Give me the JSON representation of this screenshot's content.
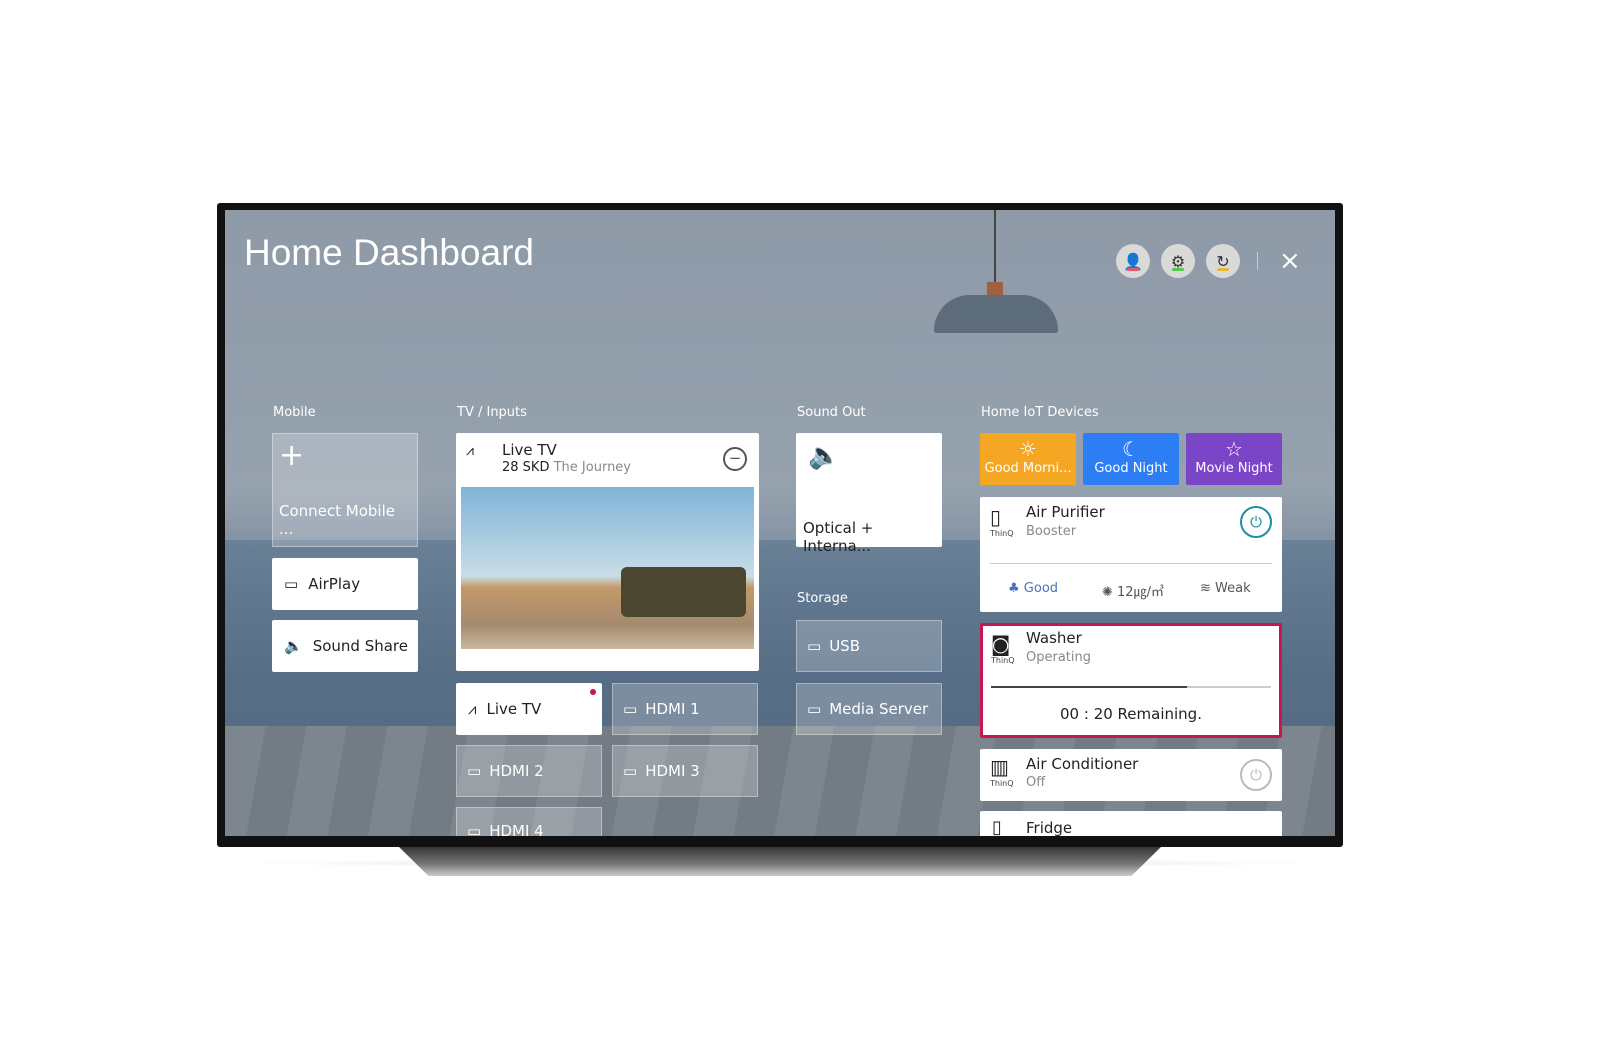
{
  "header": {
    "title": "Home Dashboard",
    "close_icon": "×"
  },
  "header_buttons": [
    {
      "name": "profile",
      "icon": "user-star-icon",
      "color": "#e35b6a"
    },
    {
      "name": "settings",
      "icon": "gear-icon",
      "color": "#56c74d"
    },
    {
      "name": "refresh",
      "icon": "refresh-icon",
      "color": "#e8b737"
    }
  ],
  "mobile": {
    "label": "Mobile",
    "connect": "Connect Mobile ...",
    "airplay": "AirPlay",
    "sound_share": "Sound Share"
  },
  "tv_inputs": {
    "label": "TV / Inputs",
    "preview_title": "Live TV",
    "channel": "28 SKD",
    "program": "The Journey",
    "inputs": [
      "Live TV",
      "HDMI 1",
      "HDMI 2",
      "HDMI 3",
      "HDMI 4"
    ]
  },
  "sound_out": {
    "label": "Sound Out",
    "value": "Optical + Interna..."
  },
  "storage": {
    "label": "Storage",
    "items": [
      "USB",
      "Media Server"
    ]
  },
  "iot": {
    "label": "Home IoT Devices",
    "scenes": [
      {
        "label": "Good Morni...",
        "color": "#f5a623",
        "icon": "☼"
      },
      {
        "label": "Good Night",
        "color": "#2d7ef5",
        "icon": "☾"
      },
      {
        "label": "Movie Night",
        "color": "#7b45c8",
        "icon": "☆"
      }
    ],
    "air_purifier": {
      "name": "Air Purifier",
      "status": "Booster",
      "quality": "Good",
      "dust": "12㎍/㎥",
      "wind": "Weak",
      "brand": "ThinQ"
    },
    "washer": {
      "name": "Washer",
      "status": "Operating",
      "remaining": "00 : 20 Remaining.",
      "progress": 0.7,
      "brand": "ThinQ",
      "accent": "#c8164f"
    },
    "air_conditioner": {
      "name": "Air Conditioner",
      "status": "Off",
      "brand": "ThinQ"
    },
    "fridge": {
      "name": "Fridge"
    }
  }
}
